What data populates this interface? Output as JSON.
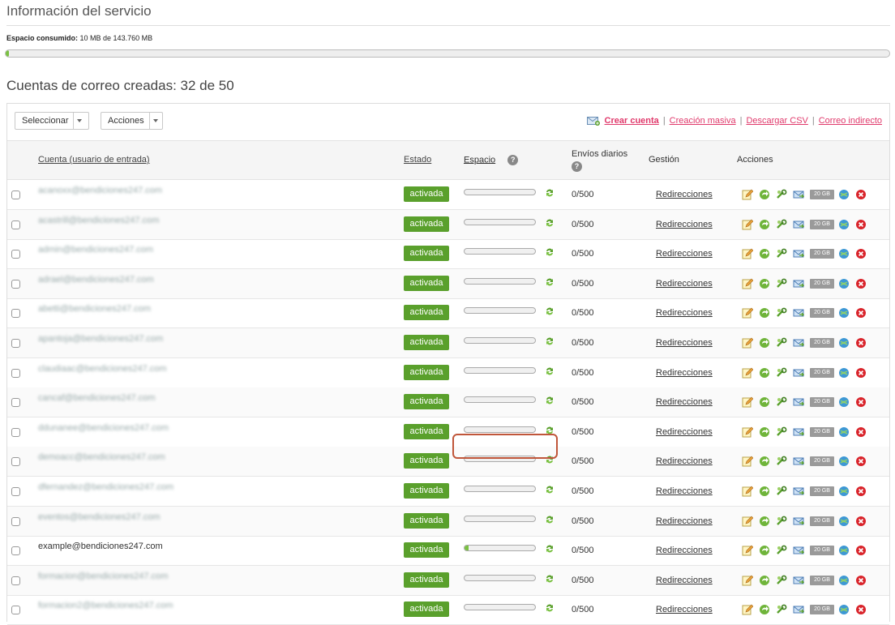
{
  "service": {
    "title": "Información del servicio",
    "consumed_label": "Espacio consumido:",
    "consumed_value": "10 MB de 143.760 MB",
    "consumed_fraction": 0.0001
  },
  "accounts": {
    "title": "Cuentas de correo creadas: 32 de 50"
  },
  "toolbar": {
    "select_label": "Seleccionar",
    "actions_label": "Acciones",
    "create_account": "Crear cuenta",
    "bulk_create": "Creación masiva",
    "download_csv": "Descargar CSV",
    "indirect_mail": "Correo indirecto",
    "separator": "|"
  },
  "table": {
    "headers": {
      "account": "Cuenta (usuario de entrada)",
      "status": "Estado",
      "space": "Espacio",
      "daily_sends": "Envíos diarios",
      "management": "Gestión",
      "actions": "Acciones"
    },
    "help_glyph": "?",
    "quota_label": "20 GB",
    "rows": [
      {
        "account": "acanoxx@bendiciones247.com",
        "blurred": true,
        "status": "activada",
        "usage": 0.0,
        "daily": "0/500",
        "management": "Redirecciones"
      },
      {
        "account": "acastrill@bendiciones247.com",
        "blurred": true,
        "status": "activada",
        "usage": 0.0,
        "daily": "0/500",
        "management": "Redirecciones"
      },
      {
        "account": "admin@bendiciones247.com",
        "blurred": true,
        "status": "activada",
        "usage": 0.0,
        "daily": "0/500",
        "management": "Redirecciones"
      },
      {
        "account": "adrael@bendiciones247.com",
        "blurred": true,
        "status": "activada",
        "usage": 0.0,
        "daily": "0/500",
        "management": "Redirecciones"
      },
      {
        "account": "abetti@bendiciones247.com",
        "blurred": true,
        "status": "activada",
        "usage": 0.0,
        "daily": "0/500",
        "management": "Redirecciones"
      },
      {
        "account": "apantoja@bendiciones247.com",
        "blurred": true,
        "status": "activada",
        "usage": 0.0,
        "daily": "0/500",
        "management": "Redirecciones"
      },
      {
        "account": "claudiaac@bendiciones247.com",
        "blurred": true,
        "status": "activada",
        "usage": 0.0,
        "daily": "0/500",
        "management": "Redirecciones"
      },
      {
        "account": "cancaf@bendiciones247.com",
        "blurred": true,
        "status": "activada",
        "usage": 0.0,
        "daily": "0/500",
        "management": "Redirecciones"
      },
      {
        "account": "ddunanee@bendiciones247.com",
        "blurred": true,
        "status": "activada",
        "usage": 0.0,
        "daily": "0/500",
        "management": "Redirecciones"
      },
      {
        "account": "demoacc@bendiciones247.com",
        "blurred": true,
        "status": "activada",
        "usage": 0.0,
        "daily": "0/500",
        "management": "Redirecciones"
      },
      {
        "account": "dfernandez@bendiciones247.com",
        "blurred": true,
        "status": "activada",
        "usage": 0.0,
        "daily": "0/500",
        "management": "Redirecciones"
      },
      {
        "account": "eventos@bendiciones247.com",
        "blurred": true,
        "status": "activada",
        "usage": 0.0,
        "daily": "0/500",
        "management": "Redirecciones"
      },
      {
        "account": "example@bendiciones247.com",
        "blurred": false,
        "status": "activada",
        "usage": 0.06,
        "daily": "0/500",
        "management": "Redirecciones"
      },
      {
        "account": "formacion@bendiciones247.com",
        "blurred": true,
        "status": "activada",
        "usage": 0.0,
        "daily": "0/500",
        "management": "Redirecciones"
      },
      {
        "account": "formacion2@bendiciones247.com",
        "blurred": true,
        "status": "activada",
        "usage": 0.0,
        "daily": "0/500",
        "management": "Redirecciones"
      }
    ]
  },
  "colors": {
    "accent_link": "#e0396b",
    "status_green": "#5aa02c",
    "bar_fill": "#7ac142",
    "highlight": "#c0563a"
  },
  "icons": [
    "edit-icon",
    "forward-icon",
    "settings-icon",
    "mail-icon",
    "quota-icon",
    "webmail-icon",
    "delete-icon",
    "refresh-icon",
    "help-icon",
    "mail-add-icon"
  ]
}
